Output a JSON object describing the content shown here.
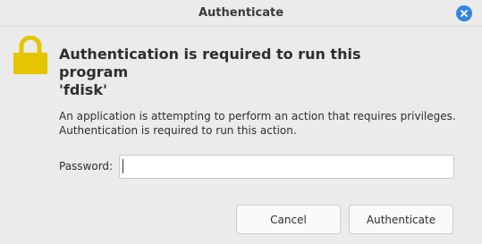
{
  "window": {
    "title": "Authenticate",
    "close_icon": "close-icon"
  },
  "dialog": {
    "icon": "lock-icon",
    "heading_line1": "Authentication is required to run this program",
    "heading_line2": "'fdisk'",
    "description_line1": "An application is attempting to perform an action that requires privileges.",
    "description_line2": "Authentication is required to run this action.",
    "password_label": "Password:",
    "password_value": "",
    "password_placeholder": ""
  },
  "buttons": {
    "cancel_label": "Cancel",
    "authenticate_label": "Authenticate"
  },
  "colors": {
    "accent": "#3584e4",
    "lock": "#e5c400",
    "background": "#ebebeb"
  }
}
